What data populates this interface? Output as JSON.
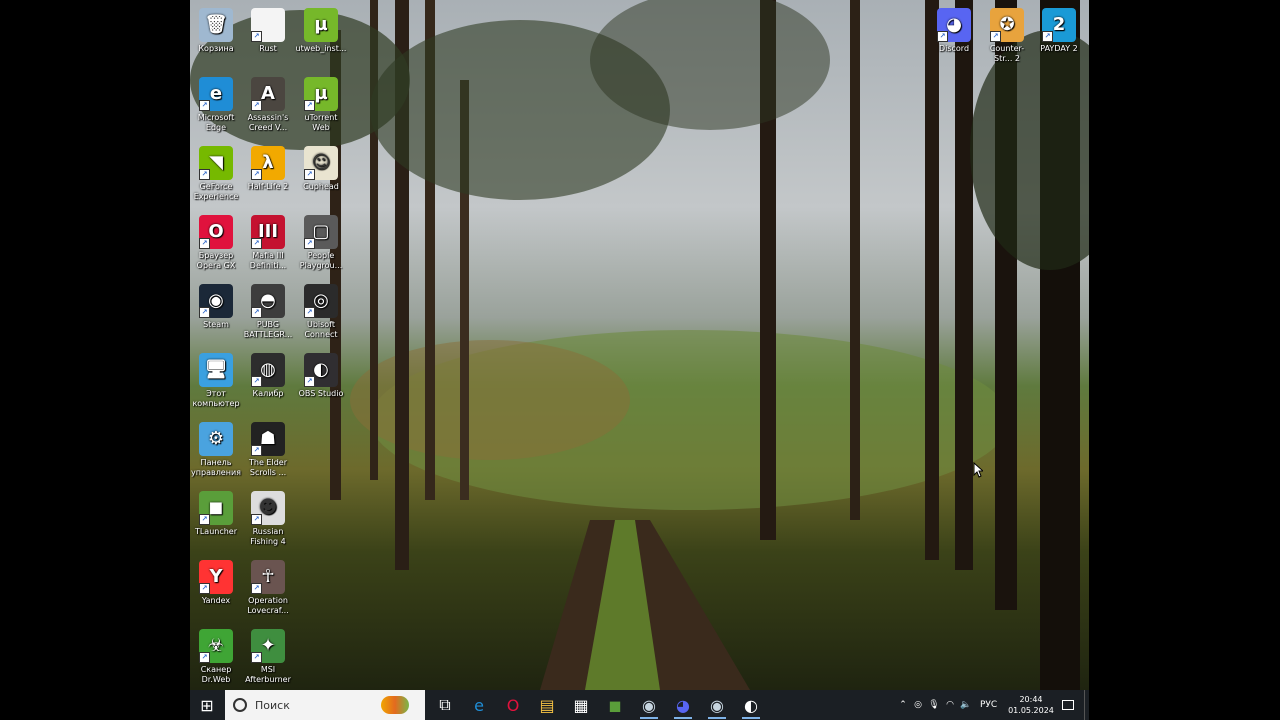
{
  "desktop": {
    "icons": [
      {
        "label": "Корзина",
        "glyph": "🗑",
        "color": "#9fb8d0",
        "shortcut": false
      },
      {
        "label": "Rust",
        "glyph": "",
        "color": "#f4f4f4",
        "shortcut": true
      },
      {
        "label": "utweb_inst...",
        "glyph": "µ",
        "color": "#76b82a",
        "shortcut": false
      },
      {
        "label": "Microsoft Edge",
        "glyph": "e",
        "color": "#1f8dd6",
        "shortcut": true
      },
      {
        "label": "Assassin's Creed V...",
        "glyph": "A",
        "color": "#4b4640",
        "shortcut": true
      },
      {
        "label": "uTorrent Web",
        "glyph": "µ",
        "color": "#76b82a",
        "shortcut": true
      },
      {
        "label": "GeForce Experience",
        "glyph": "◥",
        "color": "#76b900",
        "shortcut": true
      },
      {
        "label": "Half-Life 2",
        "glyph": "λ",
        "color": "#f2a900",
        "shortcut": true
      },
      {
        "label": "Cuphead",
        "glyph": "☺",
        "color": "#e9e4d0",
        "shortcut": true
      },
      {
        "label": "Браузер Opera GX",
        "glyph": "O",
        "color": "#e0123d",
        "shortcut": true
      },
      {
        "label": "Mafia III Definiti...",
        "glyph": "III",
        "color": "#c41230",
        "shortcut": true
      },
      {
        "label": "People Playgrou...",
        "glyph": "▢",
        "color": "#5a5a5a",
        "shortcut": true
      },
      {
        "label": "Steam",
        "glyph": "◉",
        "color": "#1b2838",
        "shortcut": true
      },
      {
        "label": "PUBG BATTLEGR...",
        "glyph": "◓",
        "color": "#3d3d3d",
        "shortcut": true
      },
      {
        "label": "Ubisoft Connect",
        "glyph": "◎",
        "color": "#2b2b2b",
        "shortcut": true
      },
      {
        "label": "Этот компьютер",
        "glyph": "🖥",
        "color": "#3aa0e0",
        "shortcut": false
      },
      {
        "label": "Калибр",
        "glyph": "◍",
        "color": "#2d2d2d",
        "shortcut": true
      },
      {
        "label": "OBS Studio",
        "glyph": "◐",
        "color": "#302e31",
        "shortcut": true
      },
      {
        "label": "Панель управления",
        "glyph": "⚙",
        "color": "#4aa3df",
        "shortcut": false
      },
      {
        "label": "The Elder Scrolls ...",
        "glyph": "☗",
        "color": "#222",
        "shortcut": true
      },
      {
        "label": "TLauncher",
        "glyph": "◼",
        "color": "#5a9e3a",
        "shortcut": true
      },
      {
        "label": "Russian Fishing 4",
        "glyph": "☻",
        "color": "#ddd",
        "shortcut": true
      },
      {
        "label": "Yandex",
        "glyph": "Y",
        "color": "#ff3333",
        "shortcut": true
      },
      {
        "label": "Operation Lovecraf...",
        "glyph": "☥",
        "color": "#6a5450",
        "shortcut": true
      },
      {
        "label": "Сканер Dr.Web",
        "glyph": "☣",
        "color": "#3fa535",
        "shortcut": true
      },
      {
        "label": "MSI Afterburner",
        "glyph": "✦",
        "color": "#3f8e3f",
        "shortcut": true
      },
      {
        "label": "Discord",
        "glyph": "◕",
        "color": "#5865f2",
        "shortcut": true
      },
      {
        "label": "Counter-Str... 2",
        "glyph": "✪",
        "color": "#e8a33d",
        "shortcut": true
      },
      {
        "label": "PAYDAY 2",
        "glyph": "2",
        "color": "#1a9ad6",
        "shortcut": true
      }
    ]
  },
  "taskbar": {
    "start_glyph": "⊞",
    "search_placeholder": "Поиск",
    "apps": [
      {
        "name": "task-view",
        "glyph": "⧉",
        "color": "#ffffff"
      },
      {
        "name": "edge",
        "glyph": "e",
        "color": "#1f8dd6"
      },
      {
        "name": "opera-gx",
        "glyph": "O",
        "color": "#e0123d"
      },
      {
        "name": "file-explorer",
        "glyph": "▤",
        "color": "#f5c244"
      },
      {
        "name": "microsoft-store",
        "glyph": "▦",
        "color": "#ffffff"
      },
      {
        "name": "tlauncher",
        "glyph": "◼",
        "color": "#5a9e3a"
      },
      {
        "name": "steam",
        "glyph": "◉",
        "color": "#c7d5e0"
      },
      {
        "name": "discord",
        "glyph": "◕",
        "color": "#5865f2"
      },
      {
        "name": "steam-2",
        "glyph": "◉",
        "color": "#c7d5e0"
      },
      {
        "name": "obs",
        "glyph": "◐",
        "color": "#ffffff"
      }
    ],
    "tray": {
      "language": "РУС",
      "time": "20:44",
      "date": "01.05.2024"
    }
  },
  "colors": {
    "taskbar": "#1b1f24",
    "accent": "#7fb3e8"
  }
}
